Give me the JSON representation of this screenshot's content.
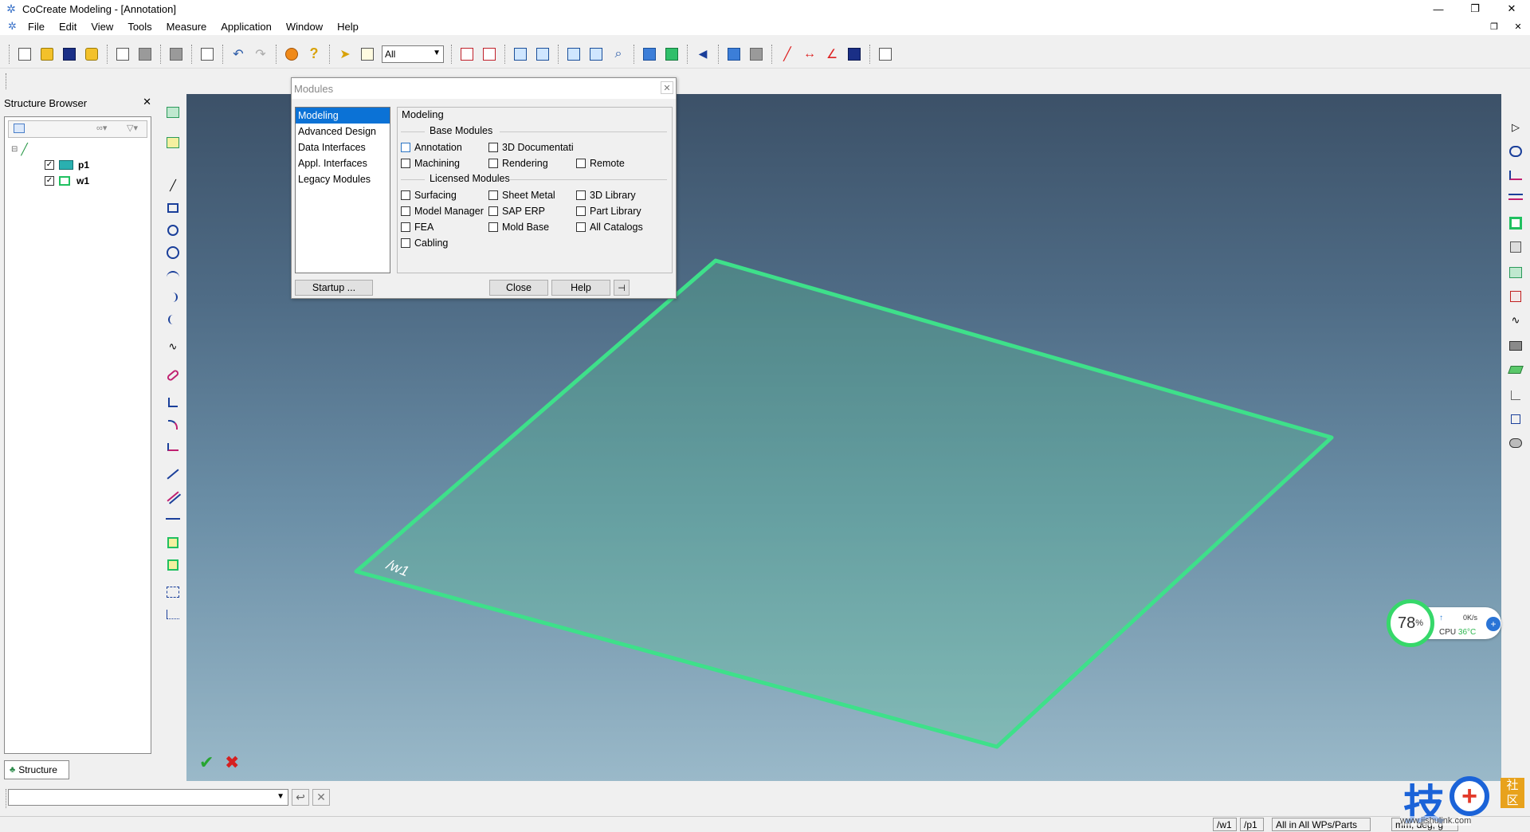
{
  "window": {
    "title": "CoCreate Modeling - [Annotation]",
    "minimize": "—",
    "maximize": "❐",
    "close": "✕",
    "mdi_restore": "❐",
    "mdi_close": "✕"
  },
  "menu": {
    "items": [
      "File",
      "Edit",
      "View",
      "Tools",
      "Measure",
      "Application",
      "Window",
      "Help"
    ]
  },
  "toolbar": {
    "filter_value": "All"
  },
  "structure_browser": {
    "title": "Structure Browser",
    "close": "✕",
    "tree": [
      {
        "label": "p1",
        "checked": true
      },
      {
        "label": "w1",
        "checked": true
      }
    ],
    "tab_label": "Structure"
  },
  "modules_dialog": {
    "title": "Modules",
    "close": "✕",
    "list": [
      "Modeling",
      "Advanced Design",
      "Data Interfaces",
      "Appl. Interfaces",
      "Legacy Modules"
    ],
    "selected": "Modeling",
    "panel_title": "Modeling",
    "base_group_label": "Base Modules",
    "licensed_group_label": "Licensed Modules",
    "base_modules": [
      "Annotation",
      "3D Documentati",
      "Machining",
      "Rendering",
      "Remote"
    ],
    "licensed_modules": [
      "Surfacing",
      "Sheet Metal",
      "3D Library",
      "Model Manager",
      "SAP ERP",
      "Part Library",
      "FEA",
      "Mold Base",
      "All Catalogs",
      "Cabling"
    ],
    "startup_button": "Startup ...",
    "close_button": "Close",
    "help_button": "Help"
  },
  "viewport": {
    "workplane_label": "/w1",
    "plane_color": "#3ee08a"
  },
  "command": {
    "input_value": "",
    "ok": "↩",
    "cancel": "✕"
  },
  "marks": {
    "accept": "✔",
    "cancel": "✖"
  },
  "status": {
    "workplane": "/w1",
    "part": "/p1",
    "selection": "All in All WPs/Parts",
    "units": "mm, deg, g"
  },
  "cpu_widget": {
    "percent": "78",
    "percent_unit": "%",
    "net_speed": "0K/s",
    "cpu_label": "CPU",
    "temperature": "36°C"
  },
  "watermark": {
    "char1": "技",
    "char2": "社",
    "char3": "区",
    "url": "www.jishulink.com"
  }
}
